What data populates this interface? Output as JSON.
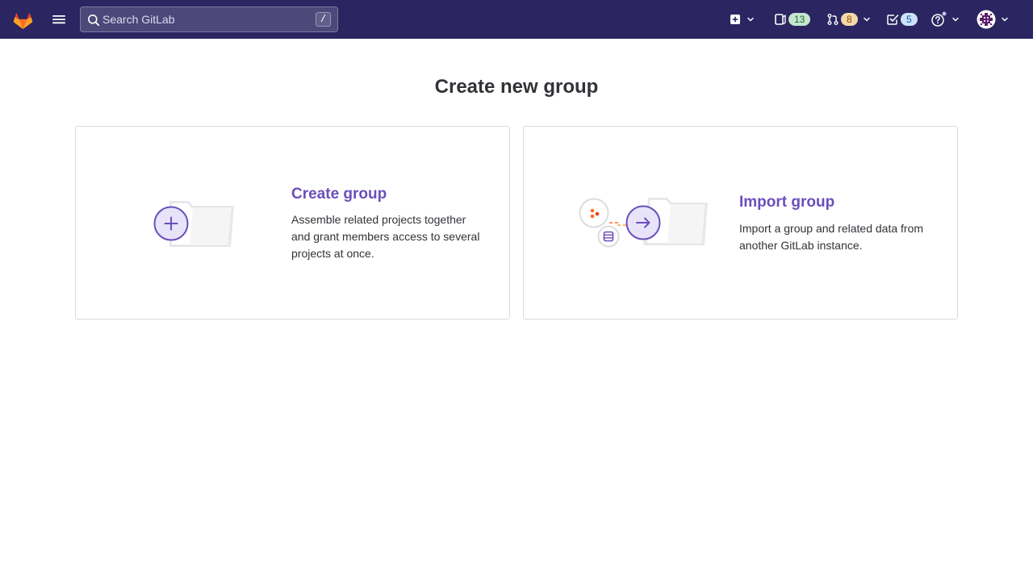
{
  "topbar": {
    "search_placeholder": "Search GitLab",
    "search_shortcut": "/",
    "issues_count": "13",
    "merge_requests_count": "8",
    "todos_count": "5"
  },
  "page": {
    "title": "Create new group"
  },
  "cards": {
    "create": {
      "title": "Create group",
      "description": "Assemble related projects together and grant members access to several projects at once."
    },
    "import": {
      "title": "Import group",
      "description": "Import a group and related data from another GitLab instance."
    }
  },
  "colors": {
    "topbar_bg": "#2b2561",
    "accent": "#6b4fbb",
    "issues_badge": "#c3e6cd",
    "mr_badge": "#f5d9a8",
    "todos_badge": "#cbe2f9"
  }
}
